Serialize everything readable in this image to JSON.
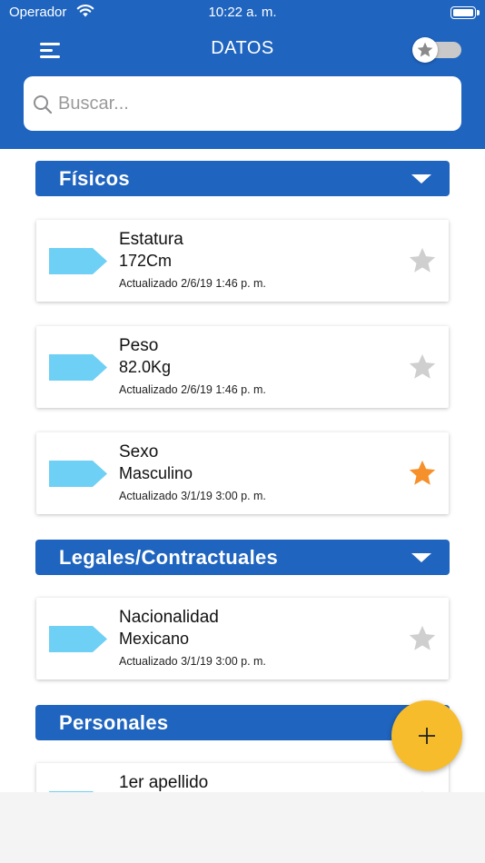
{
  "status_bar": {
    "carrier": "Operador",
    "time": "10:22 a. m."
  },
  "nav": {
    "title": "DATOS"
  },
  "search": {
    "placeholder": "Buscar...",
    "value": ""
  },
  "favorites_toggle": {
    "on": false
  },
  "colors": {
    "primary": "#1f64bf",
    "tag": "#6fd0f5",
    "star_off": "#cfcfcf",
    "star_on": "#f5902a",
    "fab": "#f7bc2b"
  },
  "sections": [
    {
      "title": "Físicos",
      "items": [
        {
          "name": "Estatura",
          "value": "172Cm",
          "updated": "Actualizado 2/6/19 1:46 p. m.",
          "favorite": false
        },
        {
          "name": "Peso",
          "value": "82.0Kg",
          "updated": "Actualizado 2/6/19 1:46 p. m.",
          "favorite": false
        },
        {
          "name": "Sexo",
          "value": "Masculino",
          "updated": "Actualizado 3/1/19 3:00 p. m.",
          "favorite": true
        }
      ]
    },
    {
      "title": "Legales/Contractuales",
      "items": [
        {
          "name": "Nacionalidad",
          "value": "Mexicano",
          "updated": "Actualizado 3/1/19 3:00 p. m.",
          "favorite": false
        }
      ]
    },
    {
      "title": "Personales",
      "items": [
        {
          "name": "1er apellido",
          "value": "",
          "updated": "",
          "favorite": false
        }
      ]
    }
  ],
  "fab": {
    "icon": "plus-icon"
  }
}
